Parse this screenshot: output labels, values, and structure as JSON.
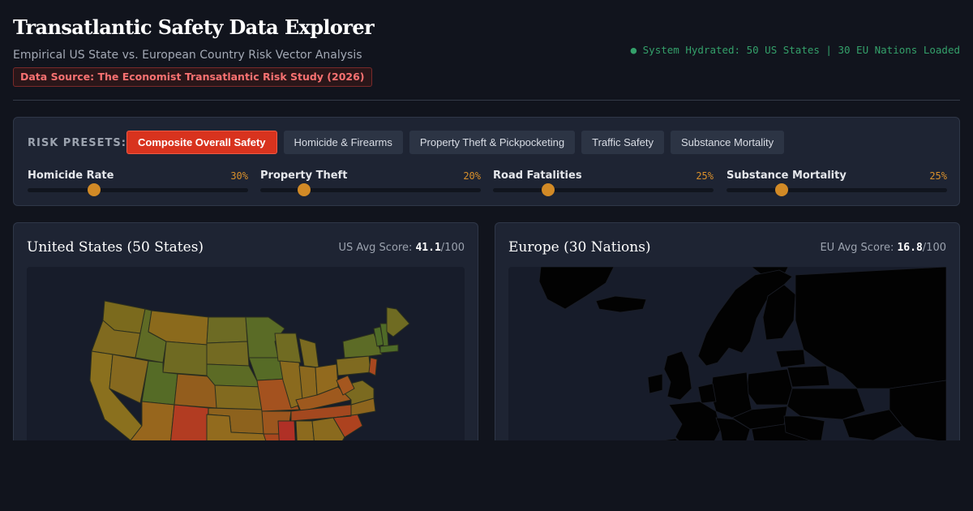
{
  "header": {
    "title": "Transatlantic Safety Data Explorer",
    "subtitle": "Empirical US State vs. European Country Risk Vector Analysis",
    "source": "Data Source: The Economist Transatlantic Risk Study (2026)",
    "status": "System Hydrated: 50 US States | 30 EU Nations Loaded"
  },
  "controls": {
    "presets_label": "RISK PRESETS:",
    "presets": [
      {
        "label": "Composite Overall Safety",
        "active": true
      },
      {
        "label": "Homicide & Firearms",
        "active": false
      },
      {
        "label": "Property Theft & Pickpocketing",
        "active": false
      },
      {
        "label": "Traffic Safety",
        "active": false
      },
      {
        "label": "Substance Mortality",
        "active": false
      }
    ],
    "sliders": [
      {
        "label": "Homicide Rate",
        "value_text": "30%",
        "value": 0.3
      },
      {
        "label": "Property Theft",
        "value_text": "20%",
        "value": 0.2
      },
      {
        "label": "Road Fatalities",
        "value_text": "25%",
        "value": 0.25
      },
      {
        "label": "Substance Mortality",
        "value_text": "25%",
        "value": 0.25
      }
    ]
  },
  "us_panel": {
    "title": "United States (50 States)",
    "score_label": "US Avg Score:",
    "score": "41.1",
    "score_suffix": "/100"
  },
  "eu_panel": {
    "title": "Europe (30 Nations)",
    "score_label": "EU Avg Score:",
    "score": "16.8",
    "score_suffix": "/100"
  },
  "colors": {
    "accent": "#d8331e",
    "slider": "#d28a26",
    "status": "#34a06a",
    "risk_low": "#4f6b2a",
    "risk_mid": "#8a6a1e",
    "risk_high": "#b83a22"
  }
}
